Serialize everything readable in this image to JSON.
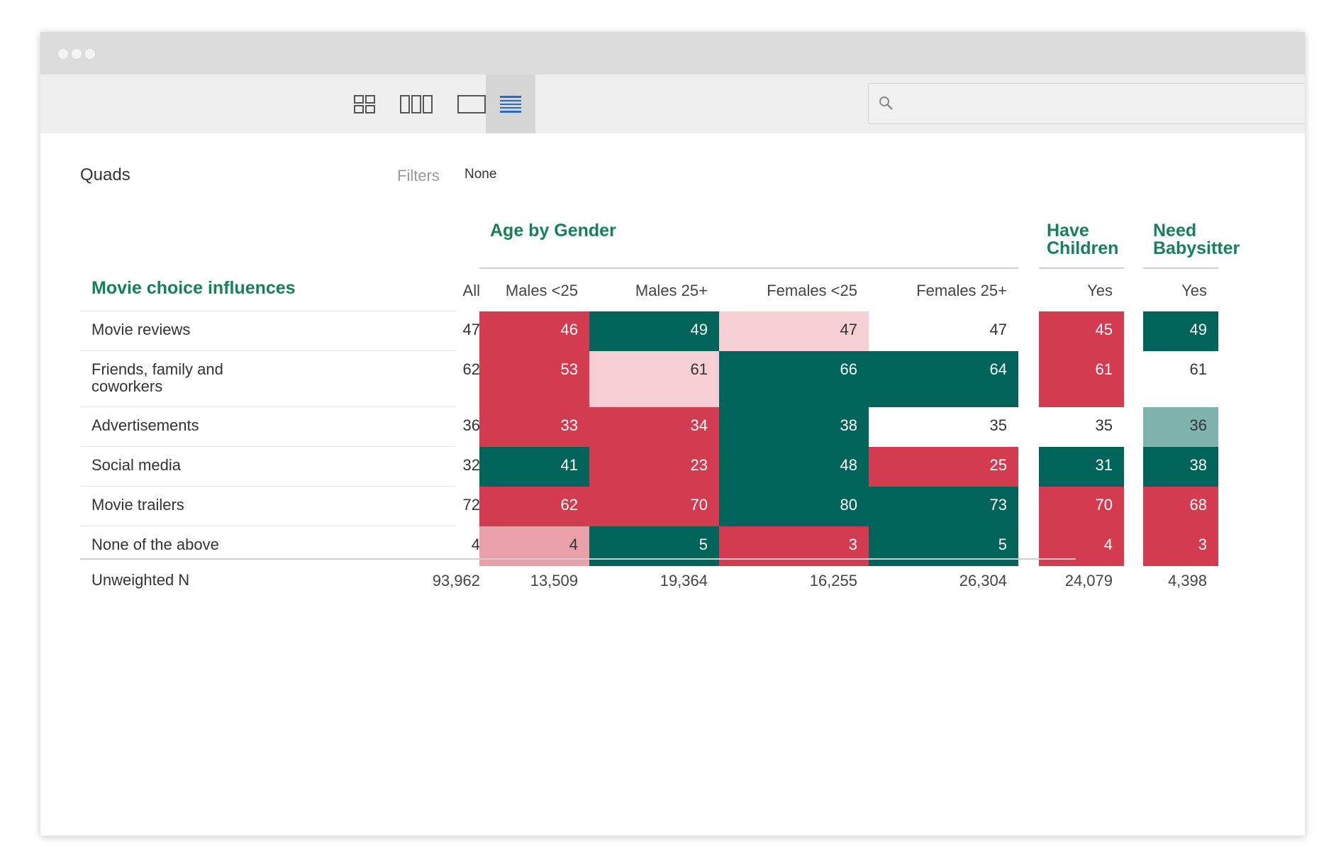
{
  "search": {
    "placeholder": "",
    "icon": "search-icon"
  },
  "toolbar": {
    "views": [
      {
        "name": "grid-view",
        "active": false
      },
      {
        "name": "columns-view",
        "active": false
      },
      {
        "name": "single-view",
        "active": false
      },
      {
        "name": "table-view",
        "active": true
      }
    ]
  },
  "page": {
    "title": "Quads",
    "filters_label": "Filters",
    "filters_value": "None"
  },
  "colors": {
    "dark_green": "#00645a",
    "light_green": "#7fb3ad",
    "red": "#d33c50",
    "light_red": "#e9a0a9",
    "pale_red": "#f5cfd4",
    "none": "#ffffff",
    "accent": "#16805a"
  },
  "table": {
    "row_title": "Movie choice influences",
    "groups": [
      {
        "label": "Age by Gender"
      },
      {
        "label": "Have Children"
      },
      {
        "label": "Need Babysitter"
      }
    ],
    "columns": [
      "All",
      "Males <25",
      "Males 25+",
      "Females <25",
      "Females 25+",
      "Yes",
      "Yes"
    ],
    "rows": [
      {
        "label": "Movie reviews",
        "values": [
          "47",
          "46",
          "49",
          "47",
          "47",
          "45",
          "49"
        ],
        "colors": [
          "none",
          "red",
          "dark_green",
          "pale_red",
          "none",
          "red",
          "dark_green"
        ]
      },
      {
        "label": "Friends, family and coworkers",
        "values": [
          "62",
          "53",
          "61",
          "66",
          "64",
          "61",
          "61"
        ],
        "colors": [
          "none",
          "red",
          "pale_red",
          "dark_green",
          "dark_green",
          "red",
          "none"
        ]
      },
      {
        "label": "Advertisements",
        "values": [
          "36",
          "33",
          "34",
          "38",
          "35",
          "35",
          "36"
        ],
        "colors": [
          "none",
          "red",
          "red",
          "dark_green",
          "none",
          "none",
          "light_green"
        ]
      },
      {
        "label": "Social media",
        "values": [
          "32",
          "41",
          "23",
          "48",
          "25",
          "31",
          "38"
        ],
        "colors": [
          "none",
          "dark_green",
          "red",
          "dark_green",
          "red",
          "dark_green",
          "dark_green"
        ]
      },
      {
        "label": "Movie trailers",
        "values": [
          "72",
          "62",
          "70",
          "80",
          "73",
          "70",
          "68"
        ],
        "colors": [
          "none",
          "red",
          "red",
          "dark_green",
          "dark_green",
          "red",
          "red"
        ]
      },
      {
        "label": "None of the above",
        "values": [
          "4",
          "4",
          "5",
          "3",
          "5",
          "4",
          "3"
        ],
        "colors": [
          "none",
          "light_red",
          "dark_green",
          "red",
          "dark_green",
          "red",
          "red"
        ]
      }
    ],
    "footer": {
      "label": "Unweighted N",
      "values": [
        "93,962",
        "13,509",
        "19,364",
        "16,255",
        "26,304",
        "24,079",
        "4,398"
      ]
    }
  }
}
